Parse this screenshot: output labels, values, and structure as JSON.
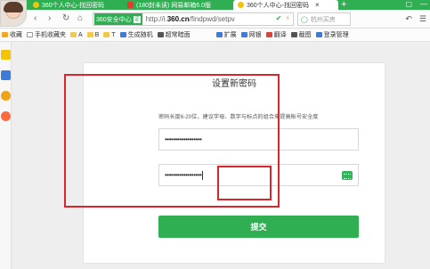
{
  "browser": {
    "tabs": [
      {
        "label": "360个人中心-找回密码",
        "active": false
      },
      {
        "label": "(180封未读) 网易邮箱6.0版",
        "active": false
      },
      {
        "label": "360个人中心-找回密码",
        "active": true
      }
    ],
    "new_tab": "+",
    "window_controls": [
      "▢",
      "—",
      "□",
      "✕"
    ],
    "nav": {
      "back": "‹",
      "forward": "›",
      "reload": "↻",
      "home": "⌂"
    },
    "address": {
      "cert_label": "360安全中心",
      "cert_badge": "证",
      "url_prefix": "http://i.",
      "url_domain": "360.cn",
      "url_rest": "/findpwd/setpv"
    },
    "search": {
      "text": "杭州买房"
    },
    "bookmarks": [
      "收藏",
      "手机收藏夹",
      "A",
      "B",
      "T",
      "生成随机",
      "超常暗面",
      "扩展",
      "网银",
      "翻译",
      "截图",
      "登录管理"
    ]
  },
  "page": {
    "title": "设置新密码",
    "hint": "密码长度6-20位，建议字母、数字与标点的组合来提高帐号安全度",
    "password1": "••••••••••••••••••",
    "password2": "••••••••••••••••••",
    "submit_label": "提交"
  },
  "colors": {
    "brand": "#2fae52",
    "annotation": "#d9252b"
  }
}
